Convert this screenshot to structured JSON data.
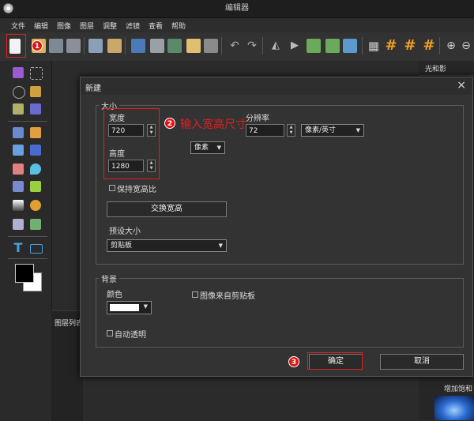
{
  "window": {
    "title": "编辑器"
  },
  "menu": [
    "文件",
    "编辑",
    "图像",
    "图层",
    "调整",
    "滤镜",
    "查看",
    "帮助"
  ],
  "right_panel": {
    "title": "光和影",
    "caption": "增加饱和"
  },
  "layers_panel": {
    "title": "图层列表"
  },
  "dialog": {
    "title": "新建",
    "close_glyph": "×",
    "size_group": "大小",
    "width_label": "宽度",
    "width_value": "720",
    "height_label": "高度",
    "height_value": "1280",
    "unit_value": "像素",
    "resolution_label": "分辨率",
    "resolution_value": "72",
    "resolution_unit": "像素/英寸",
    "keep_ratio_label": "保持宽高比",
    "swap_button": "交换宽高",
    "preset_label": "预设大小",
    "preset_value": "剪贴板",
    "background_group": "背景",
    "color_label": "颜色",
    "color_value": "#ffffff",
    "image_from_clipboard_label": "图像来自剪贴板",
    "auto_transparent_label": "自动透明",
    "ok_button": "确定",
    "cancel_button": "取消"
  },
  "annotations": {
    "badge1": "1",
    "badge2": "2",
    "badge3": "3",
    "text2": "输入宽高尺寸"
  },
  "colors": {
    "annotation_red": "#e02020",
    "foreground": "#000000",
    "background": "#ffffff"
  }
}
